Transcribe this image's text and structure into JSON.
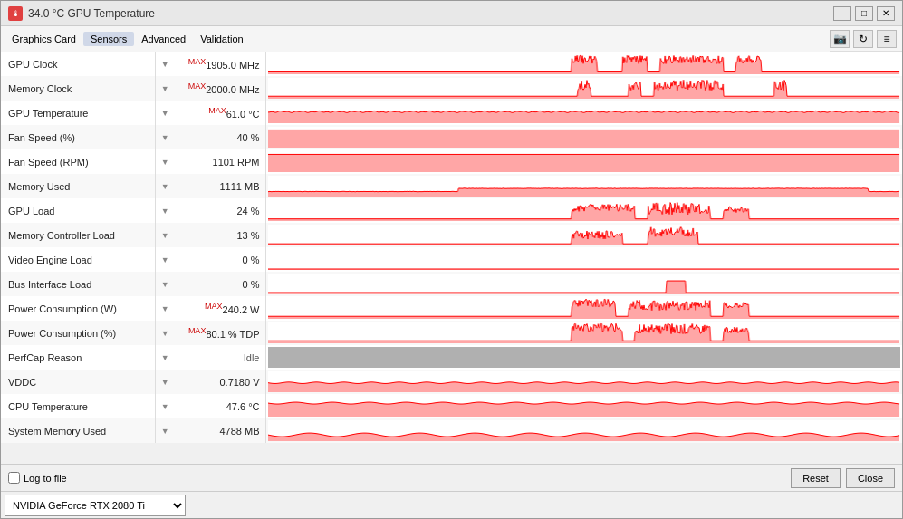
{
  "window": {
    "title": "34.0 °C GPU Temperature",
    "titleIcon": "🌡"
  },
  "menu": {
    "items": [
      "Graphics Card",
      "Sensors",
      "Advanced",
      "Validation"
    ],
    "active": "Sensors"
  },
  "toolbar": {
    "camera_label": "📷",
    "refresh_label": "↻",
    "menu_label": "≡"
  },
  "sensors": [
    {
      "name": "GPU Clock",
      "hasMax": true,
      "value": "1905.0 MHz",
      "graphType": "spiky_red",
      "graphColor": "#ff0000"
    },
    {
      "name": "Memory Clock",
      "hasMax": true,
      "value": "2000.0 MHz",
      "graphType": "spiky_red2",
      "graphColor": "#ff0000"
    },
    {
      "name": "GPU Temperature",
      "hasMax": true,
      "value": "61.0 °C",
      "graphType": "flat_mid",
      "graphColor": "#ff0000"
    },
    {
      "name": "Fan Speed (%)",
      "hasMax": false,
      "value": "40 %",
      "graphType": "flat_high",
      "graphColor": "#ff0000"
    },
    {
      "name": "Fan Speed (RPM)",
      "hasMax": false,
      "value": "1101 RPM",
      "graphType": "flat_high",
      "graphColor": "#ff0000"
    },
    {
      "name": "Memory Used",
      "hasMax": false,
      "value": "1111 MB",
      "graphType": "step_low",
      "graphColor": "#ff0000"
    },
    {
      "name": "GPU Load",
      "hasMax": false,
      "value": "24 %",
      "graphType": "spiky_mid",
      "graphColor": "#ff0000"
    },
    {
      "name": "Memory Controller Load",
      "hasMax": false,
      "value": "13 %",
      "graphType": "spiky_low",
      "graphColor": "#ff0000"
    },
    {
      "name": "Video Engine Load",
      "hasMax": false,
      "value": "0 %",
      "graphType": "flat_zero",
      "graphColor": "#ff0000"
    },
    {
      "name": "Bus Interface Load",
      "hasMax": false,
      "value": "0 %",
      "graphType": "tiny_blip",
      "graphColor": "#ff0000"
    },
    {
      "name": "Power Consumption (W)",
      "hasMax": true,
      "value": "240.2 W",
      "graphType": "spiky_mid2",
      "graphColor": "#ff0000"
    },
    {
      "name": "Power Consumption (%)",
      "hasMax": true,
      "value": "80.1 % TDP",
      "graphType": "spiky_mid3",
      "graphColor": "#ff0000"
    },
    {
      "name": "PerfCap Reason",
      "hasMax": false,
      "value": "Idle",
      "graphType": "gray_full",
      "graphColor": "#b0b0b0"
    },
    {
      "name": "VDDC",
      "hasMax": false,
      "value": "0.7180 V",
      "graphType": "flat_mid2",
      "graphColor": "#ff0000"
    },
    {
      "name": "CPU Temperature",
      "hasMax": false,
      "value": "47.6 °C",
      "graphType": "flat_mid3",
      "graphColor": "#ff0000"
    },
    {
      "name": "System Memory Used",
      "hasMax": false,
      "value": "4788 MB",
      "graphType": "step_low2",
      "graphColor": "#ff0000"
    }
  ],
  "bottom": {
    "log_label": "Log to file",
    "reset_label": "Reset",
    "close_label": "Close"
  },
  "gpu_select": {
    "value": "NVIDIA GeForce RTX 2080 Ti",
    "options": [
      "NVIDIA GeForce RTX 2080 Ti"
    ]
  }
}
